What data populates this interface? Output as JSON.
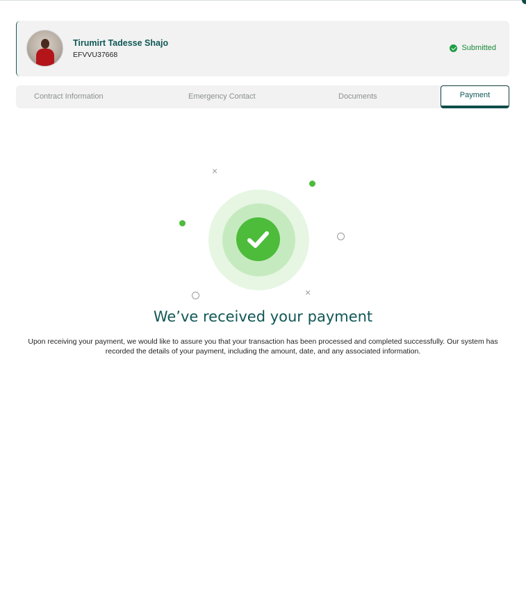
{
  "profile": {
    "name": "Tirumirt Tadesse Shajo",
    "id": "EFVVU37668",
    "status": "Submitted"
  },
  "tabs": [
    {
      "label": "Contract Information",
      "active": false
    },
    {
      "label": "Emergency Contact",
      "active": false
    },
    {
      "label": "Documents",
      "active": false
    },
    {
      "label": "Payment",
      "active": true
    }
  ],
  "confirmation": {
    "title": "We’ve received your payment",
    "message": "Upon receiving your payment, we would like to assure you that your transaction has been processed and completed successfully. Our system has recorded the details of your payment, including the amount, date, and any associated information.",
    "icon": "check-circle-icon"
  },
  "colors": {
    "brand": "#0f5755",
    "success": "#4cbc3a",
    "status_green": "#1e9e45"
  }
}
